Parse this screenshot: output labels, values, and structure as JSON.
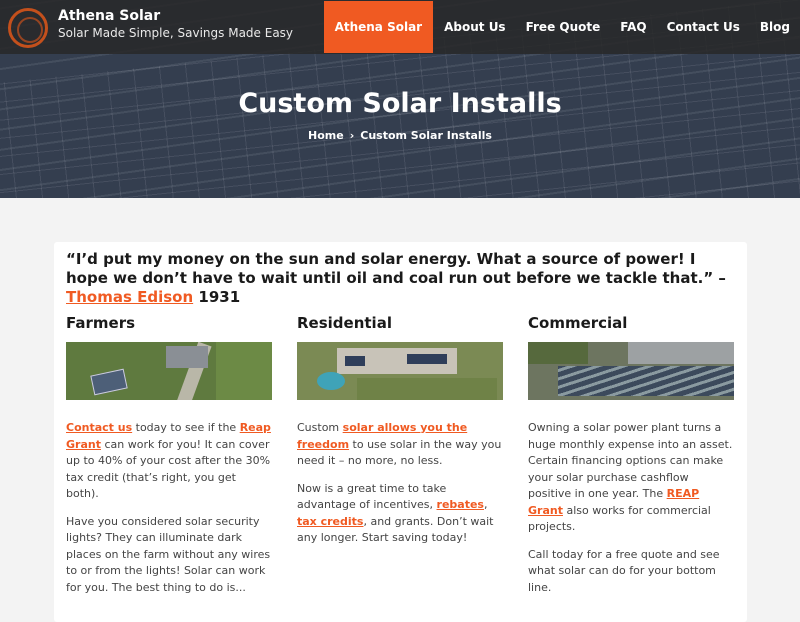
{
  "header": {
    "brand_name": "Athena Solar",
    "tagline": "Solar Made Simple, Savings Made Easy",
    "nav": [
      {
        "label": "Athena Solar",
        "active": true
      },
      {
        "label": "About Us"
      },
      {
        "label": "Free Quote"
      },
      {
        "label": "FAQ"
      },
      {
        "label": "Contact Us"
      },
      {
        "label": "Blog"
      }
    ],
    "accent_color": "#f05a22"
  },
  "hero": {
    "title": "Custom Solar Installs",
    "breadcrumb": {
      "home": "Home",
      "separator": "›",
      "current": "Custom Solar Installs"
    }
  },
  "main": {
    "quote": {
      "text": "“I’d put my money on the sun and solar energy. What a source of power! I hope we don’t have to wait until oil and coal run out before we tackle that.” –",
      "author_link": "Thomas Edison",
      "year": "1931"
    },
    "columns": [
      {
        "title": "Farmers",
        "image_icon": "farm-aerial-image",
        "p1": {
          "link1": "Contact us",
          "t1": " today to see if the ",
          "link2": "Reap Grant",
          "t2": " can work for you! It can cover up to 40% of your cost after the 30% tax credit (that’s right, you get both)."
        },
        "p2": "Have you considered solar security lights? They can illuminate dark places on the farm without any wires to or from the lights! Solar can work for you. The best thing to do is..."
      },
      {
        "title": "Residential",
        "image_icon": "residential-aerial-image",
        "p1": {
          "t1": "Custom ",
          "link1": "solar allows you the freedom",
          "t2": " to use solar in the way you need it – no more, no less."
        },
        "p2": {
          "t1": "Now is a great time to take advantage of incentives, ",
          "link1": "rebates",
          "t2": ", ",
          "link2": "tax credits",
          "t3": ", and grants. Don’t wait any longer. Start saving today!"
        }
      },
      {
        "title": "Commercial",
        "image_icon": "commercial-aerial-image",
        "p1": {
          "t1": "Owning a solar power plant turns a huge monthly expense into an asset. Certain financing options can make your solar purchase cashflow positive in one year. The ",
          "link1": "REAP Grant",
          "t2": " also works for commercial projects."
        },
        "p2": "Call today for a free quote and see what solar can do for your bottom line."
      }
    ]
  }
}
